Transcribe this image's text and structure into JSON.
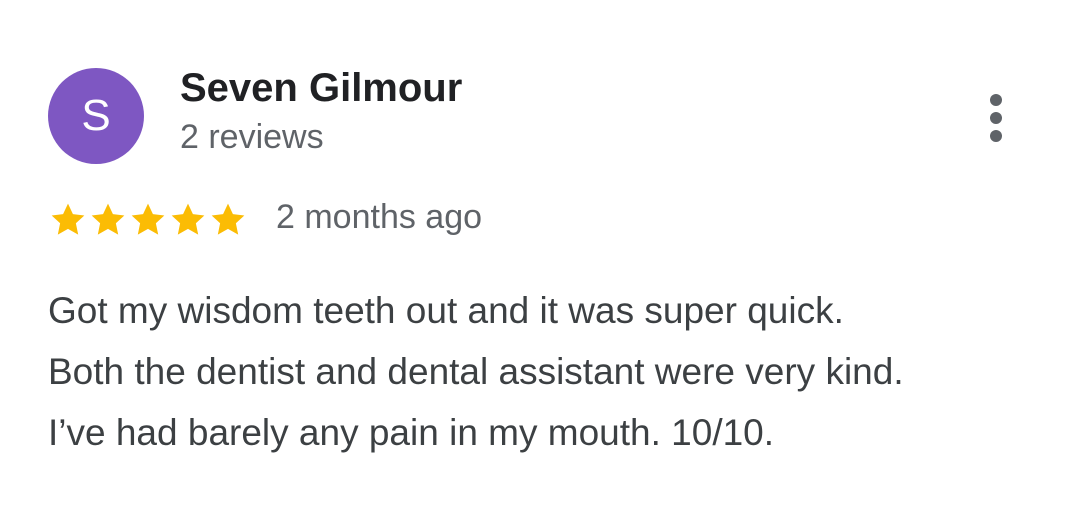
{
  "reviewer": {
    "initial": "S",
    "name": "Seven Gilmour",
    "review_count": "2 reviews",
    "avatar_color": "#7e57c2"
  },
  "menu": {
    "icon": "more-vert-icon"
  },
  "rating": {
    "stars": 5,
    "max_stars": 5,
    "star_color": "#fbbc04",
    "date": "2 months ago"
  },
  "review": {
    "lines": [
      "Got my wisdom teeth out and it was super quick.",
      "Both the dentist and dental assistant were very kind.",
      "I’ve had barely any pain in my mouth. 10/10."
    ]
  }
}
